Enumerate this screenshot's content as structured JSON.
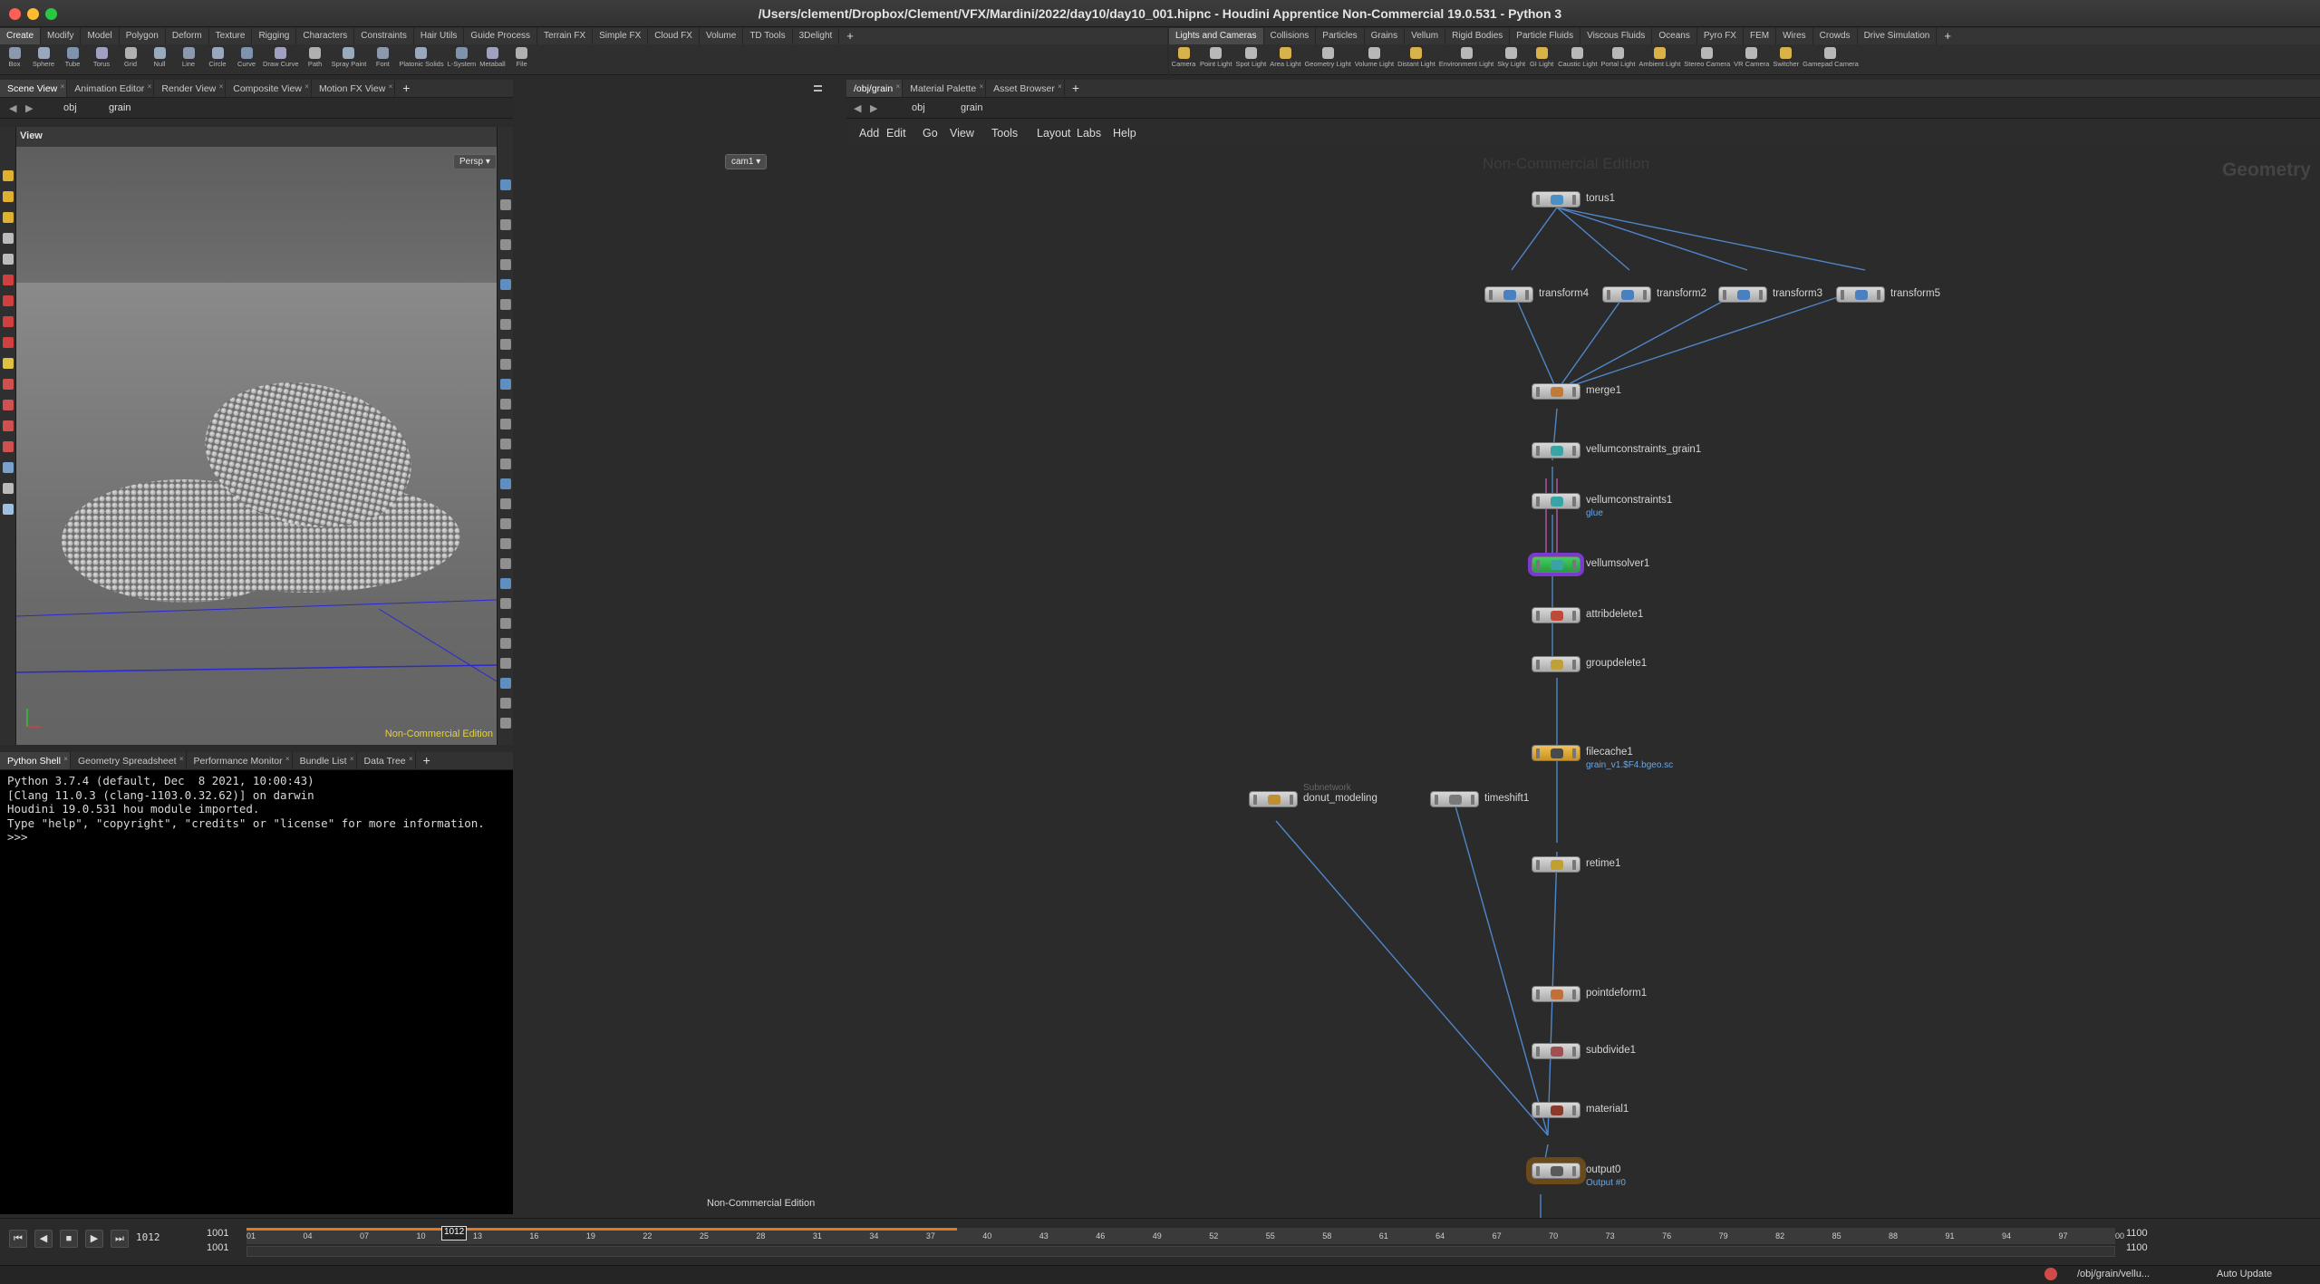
{
  "window": {
    "title": "/Users/clement/Dropbox/Clement/VFX/Mardini/2022/day10/day10_001.hipnc - Houdini Apprentice Non-Commercial 19.0.531 - Python 3"
  },
  "shelf_left": {
    "tabs": [
      "Create",
      "Modify",
      "Model",
      "Polygon",
      "Deform",
      "Texture",
      "Rigging",
      "Characters",
      "Constraints",
      "Hair Utils",
      "Guide Process",
      "Terrain FX",
      "Simple FX",
      "Cloud FX",
      "Volume",
      "TD Tools",
      "3Delight"
    ],
    "tools": [
      "Box",
      "Sphere",
      "Tube",
      "Torus",
      "Grid",
      "Null",
      "Line",
      "Circle",
      "Curve",
      "Draw Curve",
      "Path",
      "Spray Paint",
      "Font",
      "Platonic Solids",
      "L-System",
      "Metaball",
      "File"
    ]
  },
  "shelf_right": {
    "tabs": [
      "Lights and Cameras",
      "Collisions",
      "Particles",
      "Grains",
      "Vellum",
      "Rigid Bodies",
      "Particle Fluids",
      "Viscous Fluids",
      "Oceans",
      "Pyro FX",
      "FEM",
      "Wires",
      "Crowds",
      "Drive Simulation"
    ],
    "tools": [
      "Camera",
      "Point Light",
      "Spot Light",
      "Area Light",
      "Geometry Light",
      "Volume Light",
      "Distant Light",
      "Environment Light",
      "Sky Light",
      "GI Light",
      "Caustic Light",
      "Portal Light",
      "Ambient Light",
      "Stereo Camera",
      "VR Camera",
      "Switcher",
      "Gamepad Camera"
    ]
  },
  "left_pane": {
    "tabs": [
      "Scene View",
      "Animation Editor",
      "Render View",
      "Composite View",
      "Motion FX View"
    ],
    "path": [
      "obj",
      "grain"
    ],
    "viewer_label": "View",
    "persp_label": "Persp",
    "camera_label": "cam1",
    "watermark": "Non-Commercial Edition"
  },
  "bottom_left_pane": {
    "tabs": [
      "Python Shell",
      "Geometry Spreadsheet",
      "Performance Monitor",
      "Bundle List",
      "Data Tree"
    ],
    "shell_lines": [
      "Python 3.7.4 (default, Dec  8 2021, 10:00:43)",
      "[Clang 11.0.3 (clang-1103.0.32.62)] on darwin",
      "Houdini 19.0.531 hou module imported.",
      "Type \"help\", \"copyright\", \"credits\" or \"license\" for more information.",
      ">>>"
    ],
    "watermark": "Non-Commercial Edition"
  },
  "network_pane": {
    "tabs": [
      "/obj/grain",
      "Material Palette",
      "Asset Browser"
    ],
    "path": [
      "obj",
      "grain"
    ],
    "menu": [
      "Add",
      "Edit",
      "Go",
      "View",
      "Tools",
      "Layout",
      "Labs",
      "Help"
    ],
    "watermark": "Non-Commercial Edition",
    "context_label": "Geometry",
    "nodes": [
      {
        "name": "torus1",
        "icon": "#4a8fc7"
      },
      {
        "name": "transform4",
        "icon": "#4a7fc0"
      },
      {
        "name": "transform2",
        "icon": "#4a7fc0"
      },
      {
        "name": "transform3",
        "icon": "#4a7fc0"
      },
      {
        "name": "transform5",
        "icon": "#4a7fc0"
      },
      {
        "name": "merge1",
        "icon": "#c07a3a"
      },
      {
        "name": "vellumconstraints_grain1",
        "icon": "#3aa3a3"
      },
      {
        "name": "vellumconstraints1",
        "icon": "#3aa3a3",
        "sub": "glue"
      },
      {
        "name": "vellumsolver1",
        "icon": "#3aa3a3"
      },
      {
        "name": "attribdelete1",
        "icon": "#c04a3a"
      },
      {
        "name": "groupdelete1",
        "icon": "#c0a03a"
      },
      {
        "name": "filecache1",
        "icon": "#4a4a4a",
        "sub": "grain_v1.$F4.bgeo.sc"
      },
      {
        "name": "donut_modeling",
        "icon": "#c09030",
        "sub": "Subnetwork"
      },
      {
        "name": "timeshift1",
        "icon": "#7a7a7a"
      },
      {
        "name": "retime1",
        "icon": "#c0a030"
      },
      {
        "name": "pointdeform1",
        "icon": "#c0703a"
      },
      {
        "name": "subdivide1",
        "icon": "#a05050"
      },
      {
        "name": "material1",
        "icon": "#8a3a2a"
      },
      {
        "name": "output0",
        "icon": "#5a5a5a",
        "sub": "Output #0"
      }
    ]
  },
  "timeline": {
    "current_frame": "1012",
    "start_frame": "1001",
    "range_start": "1001",
    "end_frame": "1100",
    "range_end": "1100",
    "status_path": "/obj/grain/vellu...",
    "update_mode": "Auto Update"
  }
}
